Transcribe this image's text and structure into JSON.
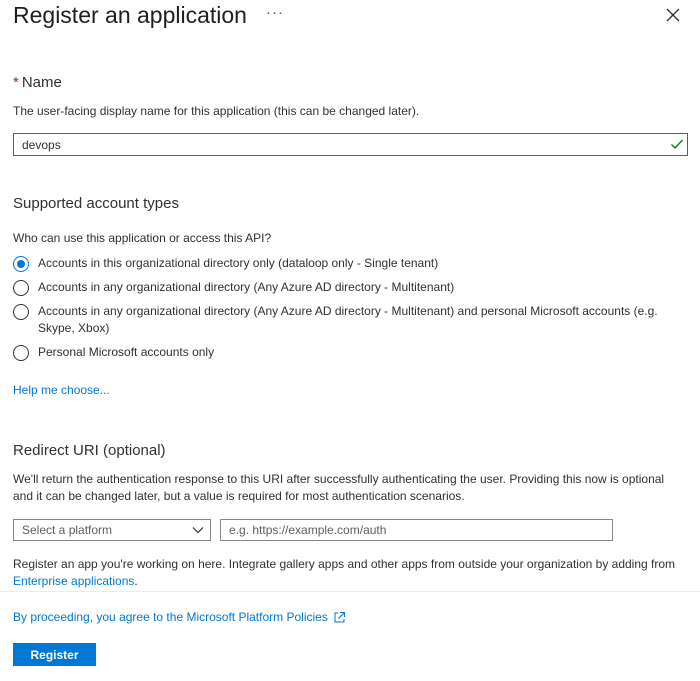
{
  "header": {
    "title": "Register an application",
    "more_label": "···"
  },
  "name_section": {
    "required_marker": "*",
    "heading": "Name",
    "description": "The user-facing display name for this application (this can be changed later).",
    "value": "devops"
  },
  "account_types": {
    "heading": "Supported account types",
    "question": "Who can use this application or access this API?",
    "selected_index": 0,
    "options": [
      {
        "label": "Accounts in this organizational directory only (dataloop only - Single tenant)"
      },
      {
        "label": "Accounts in any organizational directory (Any Azure AD directory - Multitenant)"
      },
      {
        "label_line1": "Accounts in any organizational directory (Any Azure AD directory - Multitenant) and personal Microsoft accounts (e.g.",
        "label_line2": "Skype, Xbox)"
      },
      {
        "label": "Personal Microsoft accounts only"
      }
    ],
    "help_link": "Help me choose..."
  },
  "redirect_uri": {
    "heading": "Redirect URI (optional)",
    "description_line1": "We'll return the authentication response to this URI after successfully authenticating the user. Providing this now is optional",
    "description_line2": "and it can be changed later, but a value is required for most authentication scenarios.",
    "platform_placeholder": "Select a platform",
    "uri_placeholder": "e.g. https://example.com/auth"
  },
  "gallery_note": {
    "text": "Register an app you're working on here. Integrate gallery apps and other apps from outside your organization by adding from",
    "link": "Enterprise applications",
    "suffix": "."
  },
  "footer": {
    "policy_link": "By proceeding, you agree to the Microsoft Platform Policies",
    "register_label": "Register"
  },
  "colors": {
    "accent": "#0078d4",
    "required": "#a4262c",
    "success_check": "#107c10"
  },
  "icons": [
    "ellipsis-icon",
    "close-icon",
    "checkmark-icon",
    "chevron-down-icon",
    "external-link-icon"
  ]
}
